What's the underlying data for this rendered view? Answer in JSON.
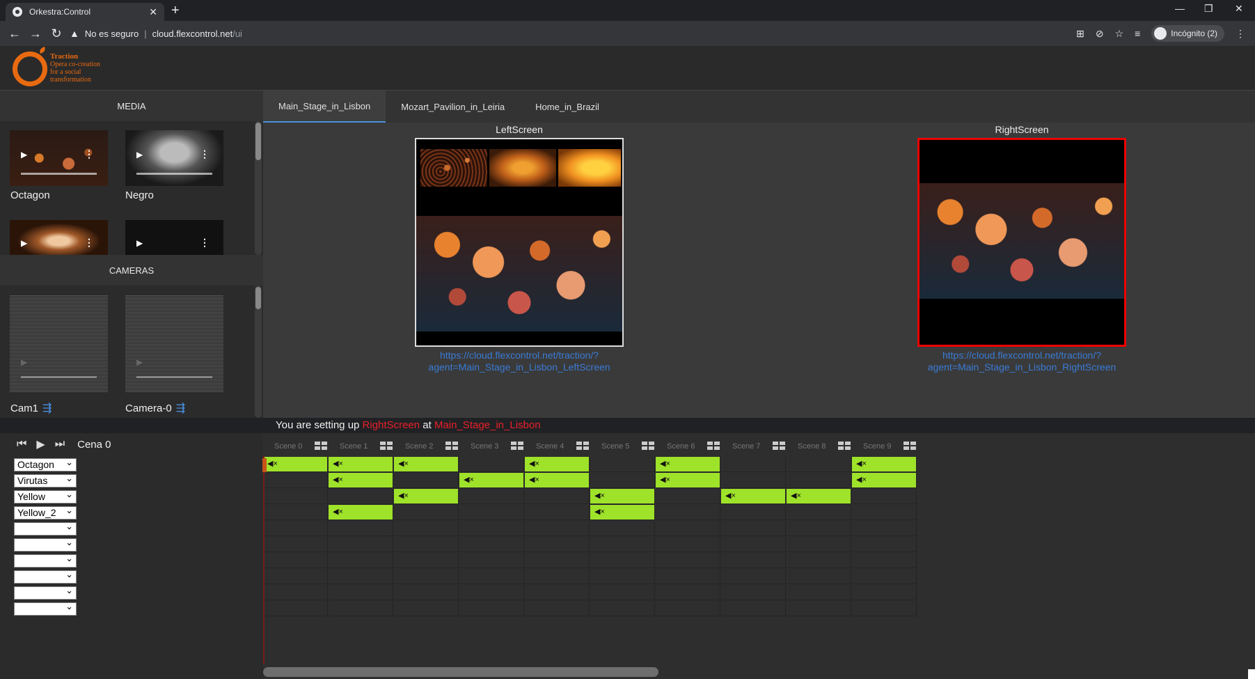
{
  "browser": {
    "tab_title": "Orkestra:Control",
    "security_label": "No es seguro",
    "url_host": "cloud.flexcontrol.net",
    "url_path": "/ui",
    "incognito_label": "Incógnito (2)"
  },
  "logo": {
    "line1": "Traction",
    "line2": "Opera co-creation",
    "line3": "for a social",
    "line4": "transformation"
  },
  "media": {
    "header": "MEDIA",
    "items": [
      {
        "label": "Octagon"
      },
      {
        "label": "Negro"
      }
    ]
  },
  "cameras": {
    "header": "CAMERAS",
    "items": [
      {
        "label": "Cam1"
      },
      {
        "label": "Camera-0"
      }
    ]
  },
  "stage_tabs": [
    "Main_Stage_in_Lisbon",
    "Mozart_Pavilion_in_Leiria",
    "Home_in_Brazil"
  ],
  "screens": {
    "left": {
      "label": "LeftScreen",
      "link_line1": "https://cloud.flexcontrol.net/traction/?",
      "link_line2": "agent=Main_Stage_in_Lisbon_LeftScreen"
    },
    "right": {
      "label": "RightScreen",
      "link_line1": "https://cloud.flexcontrol.net/traction/?",
      "link_line2": "agent=Main_Stage_in_Lisbon_RightScreen"
    }
  },
  "status": {
    "prefix": "You are setting up",
    "screen": "RightScreen",
    "mid": "at",
    "stage": "Main_Stage_in_Lisbon"
  },
  "timeline": {
    "scene_title": "Cena 0",
    "tracks": [
      "Octagon",
      "Virutas",
      "Yellow",
      "Yellow_2",
      "",
      "",
      "",
      "",
      "",
      ""
    ],
    "scenes": [
      "Scene 0",
      "Scene 1",
      "Scene 2",
      "Scene 3",
      "Scene 4",
      "Scene 5",
      "Scene 6",
      "Scene 7",
      "Scene 8",
      "Scene 9"
    ],
    "clips": [
      [
        0,
        1,
        2,
        4,
        6,
        9
      ],
      [
        1,
        3,
        4,
        6,
        9
      ],
      [
        2,
        5,
        7,
        8
      ],
      [
        1,
        5
      ]
    ],
    "mute_icon": "speaker-muted-icon"
  },
  "colors": {
    "accent": "#e86a10",
    "clip": "#9fe22a",
    "selected_border": "#ee0000",
    "link": "#3a7bd5",
    "highlight_text": "#e8202a"
  }
}
